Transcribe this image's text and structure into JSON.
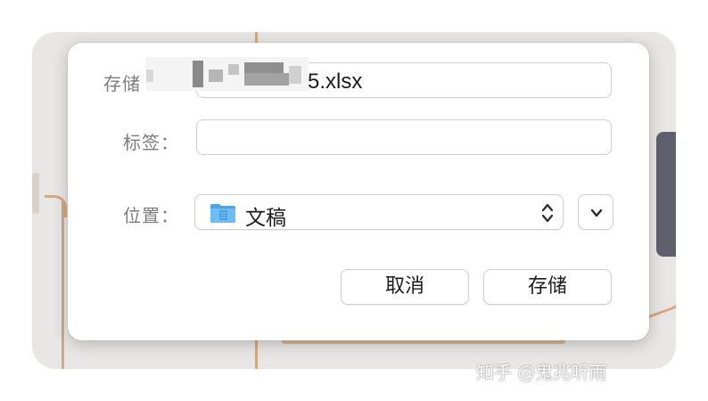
{
  "dialog": {
    "save_as_label": "存储",
    "filename_suffix": "5.xlsx",
    "tags_label": "标签：",
    "tags_value": "",
    "where_label": "位置：",
    "location": "文稿",
    "cancel_label": "取消",
    "save_label": "存储"
  },
  "watermark": {
    "text": "知乎 @鬼兆听雨"
  },
  "icons": {
    "folder": "folder-icon",
    "popup": "up-down-arrows-icon",
    "expand": "chevron-down-icon"
  },
  "colors": {
    "backdrop": "#e9e7e5",
    "accent_line": "#d6a87f",
    "folder_blue": "#5fb2f0"
  }
}
